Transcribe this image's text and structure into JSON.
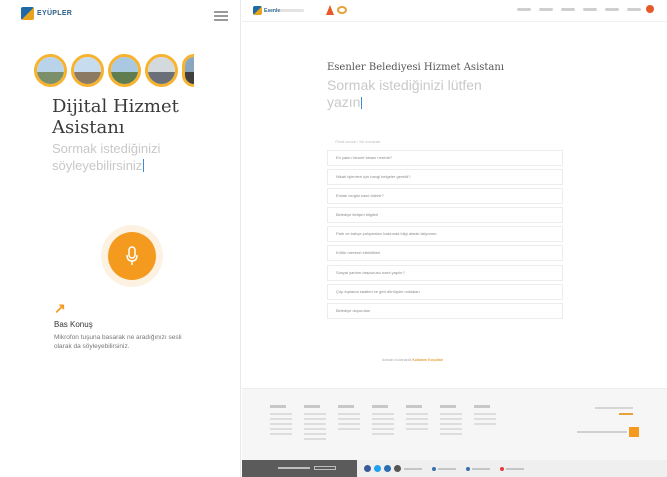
{
  "mobile": {
    "logo_text": "EYÜPLER",
    "title": "Dijital Hizmet Asistanı",
    "subtitle": "Sormak istediğinizi söyleyebilirsiniz",
    "press_label": "Bas Konuş",
    "press_description": "Mikrofon tuşuna basarak ne aradığınızı sesli olarak da söyleyebilirsiniz."
  },
  "desktop": {
    "logo_text": "Esenler",
    "title": "Esenler Belediyesi Hizmet Asistanı",
    "subtitle": "Sormak istediğinizi lütfen yazın",
    "suggestions_header": "Örnek sorular / Sık sorulanlar",
    "suggestions": [
      "En yakın hizmet binası nerede?",
      "Nikah işlemleri için hangi belgeler gerekli?",
      "Emlak vergisi nasıl ödenir?",
      "Belediye iletişim bilgileri",
      "Park ve bahçe çalışmaları hakkında bilgi almak istiyorum",
      "Kültür merkezi etkinlikleri",
      "Sosyal yardım başvurusu nasıl yapılır?",
      "Çöp toplama saatleri ve geri dönüşüm noktaları",
      "Belediye duyuruları"
    ],
    "footer_note": "Asistanı kullanarak",
    "footer_note_link": "Kullanım Koşulları"
  },
  "colors": {
    "accent": "#f39a1f",
    "brand_blue": "#1f6aa6",
    "placeholder": "#c8c8c8"
  }
}
